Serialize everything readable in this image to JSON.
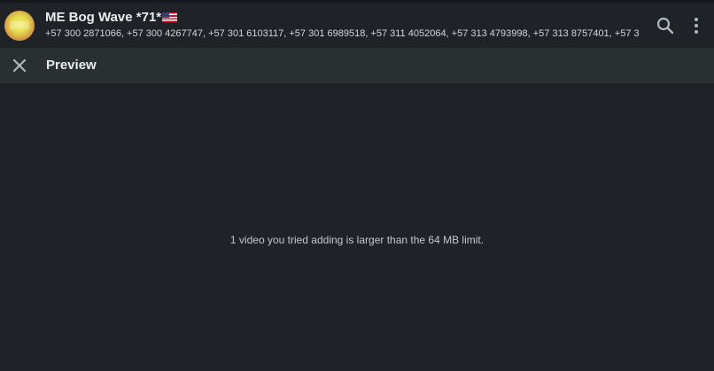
{
  "chat_header": {
    "title": "ME Bog Wave *71*",
    "title_flag": "us-flag",
    "participants": "+57 300 2871066, +57 300 4267747, +57 301 6103117, +57 301 6989518, +57 311 4052064, +57 313 4793998, +57 313 8757401, +57 3...",
    "icons": [
      "search-icon",
      "more-vertical-icon"
    ]
  },
  "preview": {
    "title": "Preview",
    "close_icon": "close-icon"
  },
  "main": {
    "message": "1 video you tried adding is larger than the 64 MB limit."
  },
  "colors": {
    "background": "#1f2328",
    "bar": "#2a2f32",
    "primary_text": "#e9edef",
    "secondary_text": "#d1d7db",
    "icon": "#aebac1"
  }
}
